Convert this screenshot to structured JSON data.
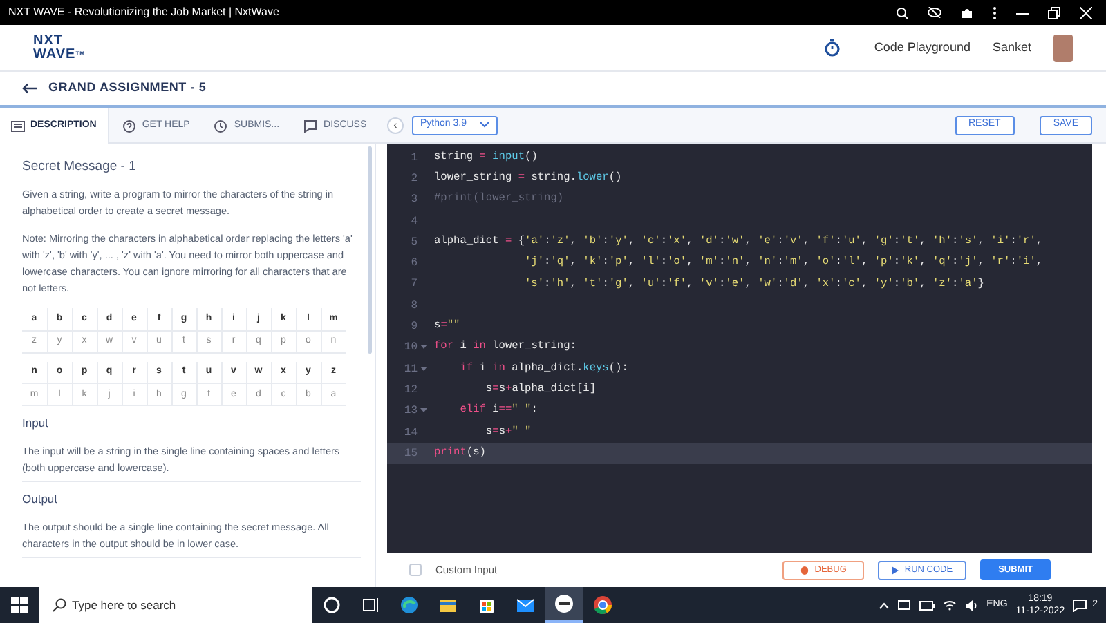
{
  "window": {
    "title": "NXT WAVE - Revolutionizing the Job Market | NxtWave"
  },
  "header": {
    "logo_lines": [
      "NXT",
      "WAVE"
    ],
    "logo_mark": "TM",
    "nav_link": "Code Playground",
    "user_name": "Sanket"
  },
  "breadcrumb": {
    "title": "GRAND ASSIGNMENT - 5"
  },
  "tabs": [
    {
      "label": "DESCRIPTION",
      "selected": true,
      "kind": "description"
    },
    {
      "label": "GET HELP",
      "selected": false,
      "kind": "help"
    },
    {
      "label": "SUBMIS...",
      "selected": false,
      "kind": "history"
    },
    {
      "label": "DISCUSS",
      "selected": false,
      "kind": "discuss"
    }
  ],
  "toolbar": {
    "collapse": "‹",
    "language": "Python 3.9",
    "reset": "RESET",
    "save": "SAVE"
  },
  "problem": {
    "title": "Secret Message - 1",
    "paragraphs": [
      "Given a string, write a program to mirror the characters of the string in alphabetical order to create a secret message.",
      "Note: Mirroring the characters in alphabetical order replacing the letters 'a' with 'z', 'b' with 'y', ... , 'z' with 'a'. You need to mirror both uppercase and lowercase characters. You can ignore mirroring for all characters that are not letters."
    ],
    "letter_tables": [
      {
        "top": [
          "a",
          "b",
          "c",
          "d",
          "e",
          "f",
          "g",
          "h",
          "i",
          "j",
          "k",
          "l",
          "m"
        ],
        "bottom": [
          "z",
          "y",
          "x",
          "w",
          "v",
          "u",
          "t",
          "s",
          "r",
          "q",
          "p",
          "o",
          "n"
        ]
      },
      {
        "top": [
          "n",
          "o",
          "p",
          "q",
          "r",
          "s",
          "t",
          "u",
          "v",
          "w",
          "x",
          "y",
          "z"
        ],
        "bottom": [
          "m",
          "l",
          "k",
          "j",
          "i",
          "h",
          "g",
          "f",
          "e",
          "d",
          "c",
          "b",
          "a"
        ]
      }
    ],
    "sections": [
      {
        "heading": "Input",
        "text": "The input will be a string in the single line containing spaces and letters (both uppercase and lowercase)."
      },
      {
        "heading": "Output",
        "text": "The output should be a single line containing the secret message. All characters in the output should be in lower case."
      }
    ]
  },
  "editor": {
    "lines": [
      {
        "number": "1",
        "fold": false,
        "active": false,
        "tokens": [
          {
            "kind": "plain",
            "text": "string "
          },
          {
            "kind": "op",
            "text": "= "
          },
          {
            "kind": "fn",
            "text": "input"
          },
          {
            "kind": "plain",
            "text": "()"
          }
        ]
      },
      {
        "number": "2",
        "fold": false,
        "active": false,
        "tokens": [
          {
            "kind": "plain",
            "text": "lower_string "
          },
          {
            "kind": "op",
            "text": "="
          },
          {
            "kind": "plain",
            "text": " string."
          },
          {
            "kind": "fn",
            "text": "lower"
          },
          {
            "kind": "plain",
            "text": "()"
          }
        ]
      },
      {
        "number": "3",
        "fold": false,
        "active": false,
        "tokens": [
          {
            "kind": "comment",
            "text": "#print(lower_string)"
          }
        ]
      },
      {
        "number": "4",
        "fold": false,
        "active": false
      },
      {
        "number": "5",
        "fold": false,
        "active": false,
        "tokens": [
          {
            "kind": "plain",
            "text": "alpha_dict "
          },
          {
            "kind": "op",
            "text": "="
          },
          {
            "kind": "plain",
            "text": " {"
          },
          {
            "kind": "str",
            "text": "'a'"
          },
          {
            "kind": "plain",
            "text": ":"
          },
          {
            "kind": "str",
            "text": "'z'"
          },
          {
            "kind": "plain",
            "text": ", "
          },
          {
            "kind": "str",
            "text": "'b'"
          },
          {
            "kind": "plain",
            "text": ":"
          },
          {
            "kind": "str",
            "text": "'y'"
          },
          {
            "kind": "plain",
            "text": ", "
          },
          {
            "kind": "str",
            "text": "'c'"
          },
          {
            "kind": "plain",
            "text": ":"
          },
          {
            "kind": "str",
            "text": "'x'"
          },
          {
            "kind": "plain",
            "text": ", "
          },
          {
            "kind": "str",
            "text": "'d'"
          },
          {
            "kind": "plain",
            "text": ":"
          },
          {
            "kind": "str",
            "text": "'w'"
          },
          {
            "kind": "plain",
            "text": ", "
          },
          {
            "kind": "str",
            "text": "'e'"
          },
          {
            "kind": "plain",
            "text": ":"
          },
          {
            "kind": "str",
            "text": "'v'"
          },
          {
            "kind": "plain",
            "text": ", "
          },
          {
            "kind": "str",
            "text": "'f'"
          },
          {
            "kind": "plain",
            "text": ":"
          },
          {
            "kind": "str",
            "text": "'u'"
          },
          {
            "kind": "plain",
            "text": ", "
          },
          {
            "kind": "str",
            "text": "'g'"
          },
          {
            "kind": "plain",
            "text": ":"
          },
          {
            "kind": "str",
            "text": "'t'"
          },
          {
            "kind": "plain",
            "text": ", "
          },
          {
            "kind": "str",
            "text": "'h'"
          },
          {
            "kind": "plain",
            "text": ":"
          },
          {
            "kind": "str",
            "text": "'s'"
          },
          {
            "kind": "plain",
            "text": ", "
          },
          {
            "kind": "str",
            "text": "'i'"
          },
          {
            "kind": "plain",
            "text": ":"
          },
          {
            "kind": "str",
            "text": "'r'"
          },
          {
            "kind": "plain",
            "text": ","
          }
        ]
      },
      {
        "number": "6",
        "fold": false,
        "active": false,
        "tokens": [
          {
            "kind": "str",
            "text": "              'j'"
          },
          {
            "kind": "plain",
            "text": ":"
          },
          {
            "kind": "str",
            "text": "'q'"
          },
          {
            "kind": "plain",
            "text": ", "
          },
          {
            "kind": "str",
            "text": "'k'"
          },
          {
            "kind": "plain",
            "text": ":"
          },
          {
            "kind": "str",
            "text": "'p'"
          },
          {
            "kind": "plain",
            "text": ", "
          },
          {
            "kind": "str",
            "text": "'l'"
          },
          {
            "kind": "plain",
            "text": ":"
          },
          {
            "kind": "str",
            "text": "'o'"
          },
          {
            "kind": "plain",
            "text": ", "
          },
          {
            "kind": "str",
            "text": "'m'"
          },
          {
            "kind": "plain",
            "text": ":"
          },
          {
            "kind": "str",
            "text": "'n'"
          },
          {
            "kind": "plain",
            "text": ", "
          },
          {
            "kind": "str",
            "text": "'n'"
          },
          {
            "kind": "plain",
            "text": ":"
          },
          {
            "kind": "str",
            "text": "'m'"
          },
          {
            "kind": "plain",
            "text": ", "
          },
          {
            "kind": "str",
            "text": "'o'"
          },
          {
            "kind": "plain",
            "text": ":"
          },
          {
            "kind": "str",
            "text": "'l'"
          },
          {
            "kind": "plain",
            "text": ", "
          },
          {
            "kind": "str",
            "text": "'p'"
          },
          {
            "kind": "plain",
            "text": ":"
          },
          {
            "kind": "str",
            "text": "'k'"
          },
          {
            "kind": "plain",
            "text": ", "
          },
          {
            "kind": "str",
            "text": "'q'"
          },
          {
            "kind": "plain",
            "text": ":"
          },
          {
            "kind": "str",
            "text": "'j'"
          },
          {
            "kind": "plain",
            "text": ", "
          },
          {
            "kind": "str",
            "text": "'r'"
          },
          {
            "kind": "plain",
            "text": ":"
          },
          {
            "kind": "str",
            "text": "'i'"
          },
          {
            "kind": "plain",
            "text": ","
          }
        ]
      },
      {
        "number": "7",
        "fold": false,
        "active": false,
        "tokens": [
          {
            "kind": "str",
            "text": "              's'"
          },
          {
            "kind": "plain",
            "text": ":"
          },
          {
            "kind": "str",
            "text": "'h'"
          },
          {
            "kind": "plain",
            "text": ", "
          },
          {
            "kind": "str",
            "text": "'t'"
          },
          {
            "kind": "plain",
            "text": ":"
          },
          {
            "kind": "str",
            "text": "'g'"
          },
          {
            "kind": "plain",
            "text": ", "
          },
          {
            "kind": "str",
            "text": "'u'"
          },
          {
            "kind": "plain",
            "text": ":"
          },
          {
            "kind": "str",
            "text": "'f'"
          },
          {
            "kind": "plain",
            "text": ", "
          },
          {
            "kind": "str",
            "text": "'v'"
          },
          {
            "kind": "plain",
            "text": ":"
          },
          {
            "kind": "str",
            "text": "'e'"
          },
          {
            "kind": "plain",
            "text": ", "
          },
          {
            "kind": "str",
            "text": "'w'"
          },
          {
            "kind": "plain",
            "text": ":"
          },
          {
            "kind": "str",
            "text": "'d'"
          },
          {
            "kind": "plain",
            "text": ", "
          },
          {
            "kind": "str",
            "text": "'x'"
          },
          {
            "kind": "plain",
            "text": ":"
          },
          {
            "kind": "str",
            "text": "'c'"
          },
          {
            "kind": "plain",
            "text": ", "
          },
          {
            "kind": "str",
            "text": "'y'"
          },
          {
            "kind": "plain",
            "text": ":"
          },
          {
            "kind": "str",
            "text": "'b'"
          },
          {
            "kind": "plain",
            "text": ", "
          },
          {
            "kind": "str",
            "text": "'z'"
          },
          {
            "kind": "plain",
            "text": ":"
          },
          {
            "kind": "str",
            "text": "'a'"
          },
          {
            "kind": "plain",
            "text": "}"
          }
        ]
      },
      {
        "number": "8",
        "fold": false,
        "active": false
      },
      {
        "number": "9",
        "fold": false,
        "active": false,
        "tokens": [
          {
            "kind": "plain",
            "text": "s"
          },
          {
            "kind": "op",
            "text": "="
          },
          {
            "kind": "str",
            "text": "\"\""
          }
        ]
      },
      {
        "number": "10",
        "fold": true,
        "active": false,
        "tokens": [
          {
            "kind": "kw",
            "text": "for"
          },
          {
            "kind": "plain",
            "text": " i "
          },
          {
            "kind": "kw",
            "text": "in"
          },
          {
            "kind": "plain",
            "text": " lower_string:"
          }
        ]
      },
      {
        "number": "11",
        "fold": true,
        "active": false,
        "tokens": [
          {
            "kind": "kw",
            "text": "    if"
          },
          {
            "kind": "plain",
            "text": " i "
          },
          {
            "kind": "kw",
            "text": "in"
          },
          {
            "kind": "plain",
            "text": " alpha_dict."
          },
          {
            "kind": "fn",
            "text": "keys"
          },
          {
            "kind": "plain",
            "text": "():"
          }
        ]
      },
      {
        "number": "12",
        "fold": false,
        "active": false,
        "tokens": [
          {
            "kind": "plain",
            "text": "        s"
          },
          {
            "kind": "op",
            "text": "="
          },
          {
            "kind": "plain",
            "text": "s"
          },
          {
            "kind": "op",
            "text": "+"
          },
          {
            "kind": "plain",
            "text": "alpha_dict[i]"
          }
        ]
      },
      {
        "number": "13",
        "fold": true,
        "active": false,
        "tokens": [
          {
            "kind": "kw",
            "text": "    elif"
          },
          {
            "kind": "plain",
            "text": " i"
          },
          {
            "kind": "op",
            "text": "=="
          },
          {
            "kind": "str",
            "text": "\" \""
          },
          {
            "kind": "plain",
            "text": ":"
          }
        ]
      },
      {
        "number": "14",
        "fold": false,
        "active": false,
        "tokens": [
          {
            "kind": "plain",
            "text": "        s"
          },
          {
            "kind": "op",
            "text": "="
          },
          {
            "kind": "plain",
            "text": "s"
          },
          {
            "kind": "op",
            "text": "+"
          },
          {
            "kind": "str",
            "text": "\" \""
          }
        ]
      },
      {
        "number": "15",
        "fold": false,
        "active": true,
        "tokens": [
          {
            "kind": "kw",
            "text": "print"
          },
          {
            "kind": "plain",
            "text": "(s)"
          }
        ]
      }
    ]
  },
  "footer": {
    "custom_input": {
      "label": "Custom Input",
      "checked": false
    },
    "debug": "DEBUG",
    "run": "RUN CODE",
    "submit": "SUBMIT"
  },
  "taskbar": {
    "search_placeholder": "Type here to search",
    "apps": [
      {
        "kind": "cortana",
        "selected": false
      },
      {
        "kind": "taskview",
        "selected": false
      },
      {
        "kind": "edge",
        "selected": false
      },
      {
        "kind": "explorer",
        "selected": false
      },
      {
        "kind": "store",
        "selected": false
      },
      {
        "kind": "mail",
        "selected": false
      },
      {
        "kind": "nxtwave",
        "selected": true
      },
      {
        "kind": "chrome",
        "selected": false
      }
    ],
    "language": "ENG",
    "time": "18:19",
    "date": "11-12-2022",
    "notifications": "2"
  }
}
